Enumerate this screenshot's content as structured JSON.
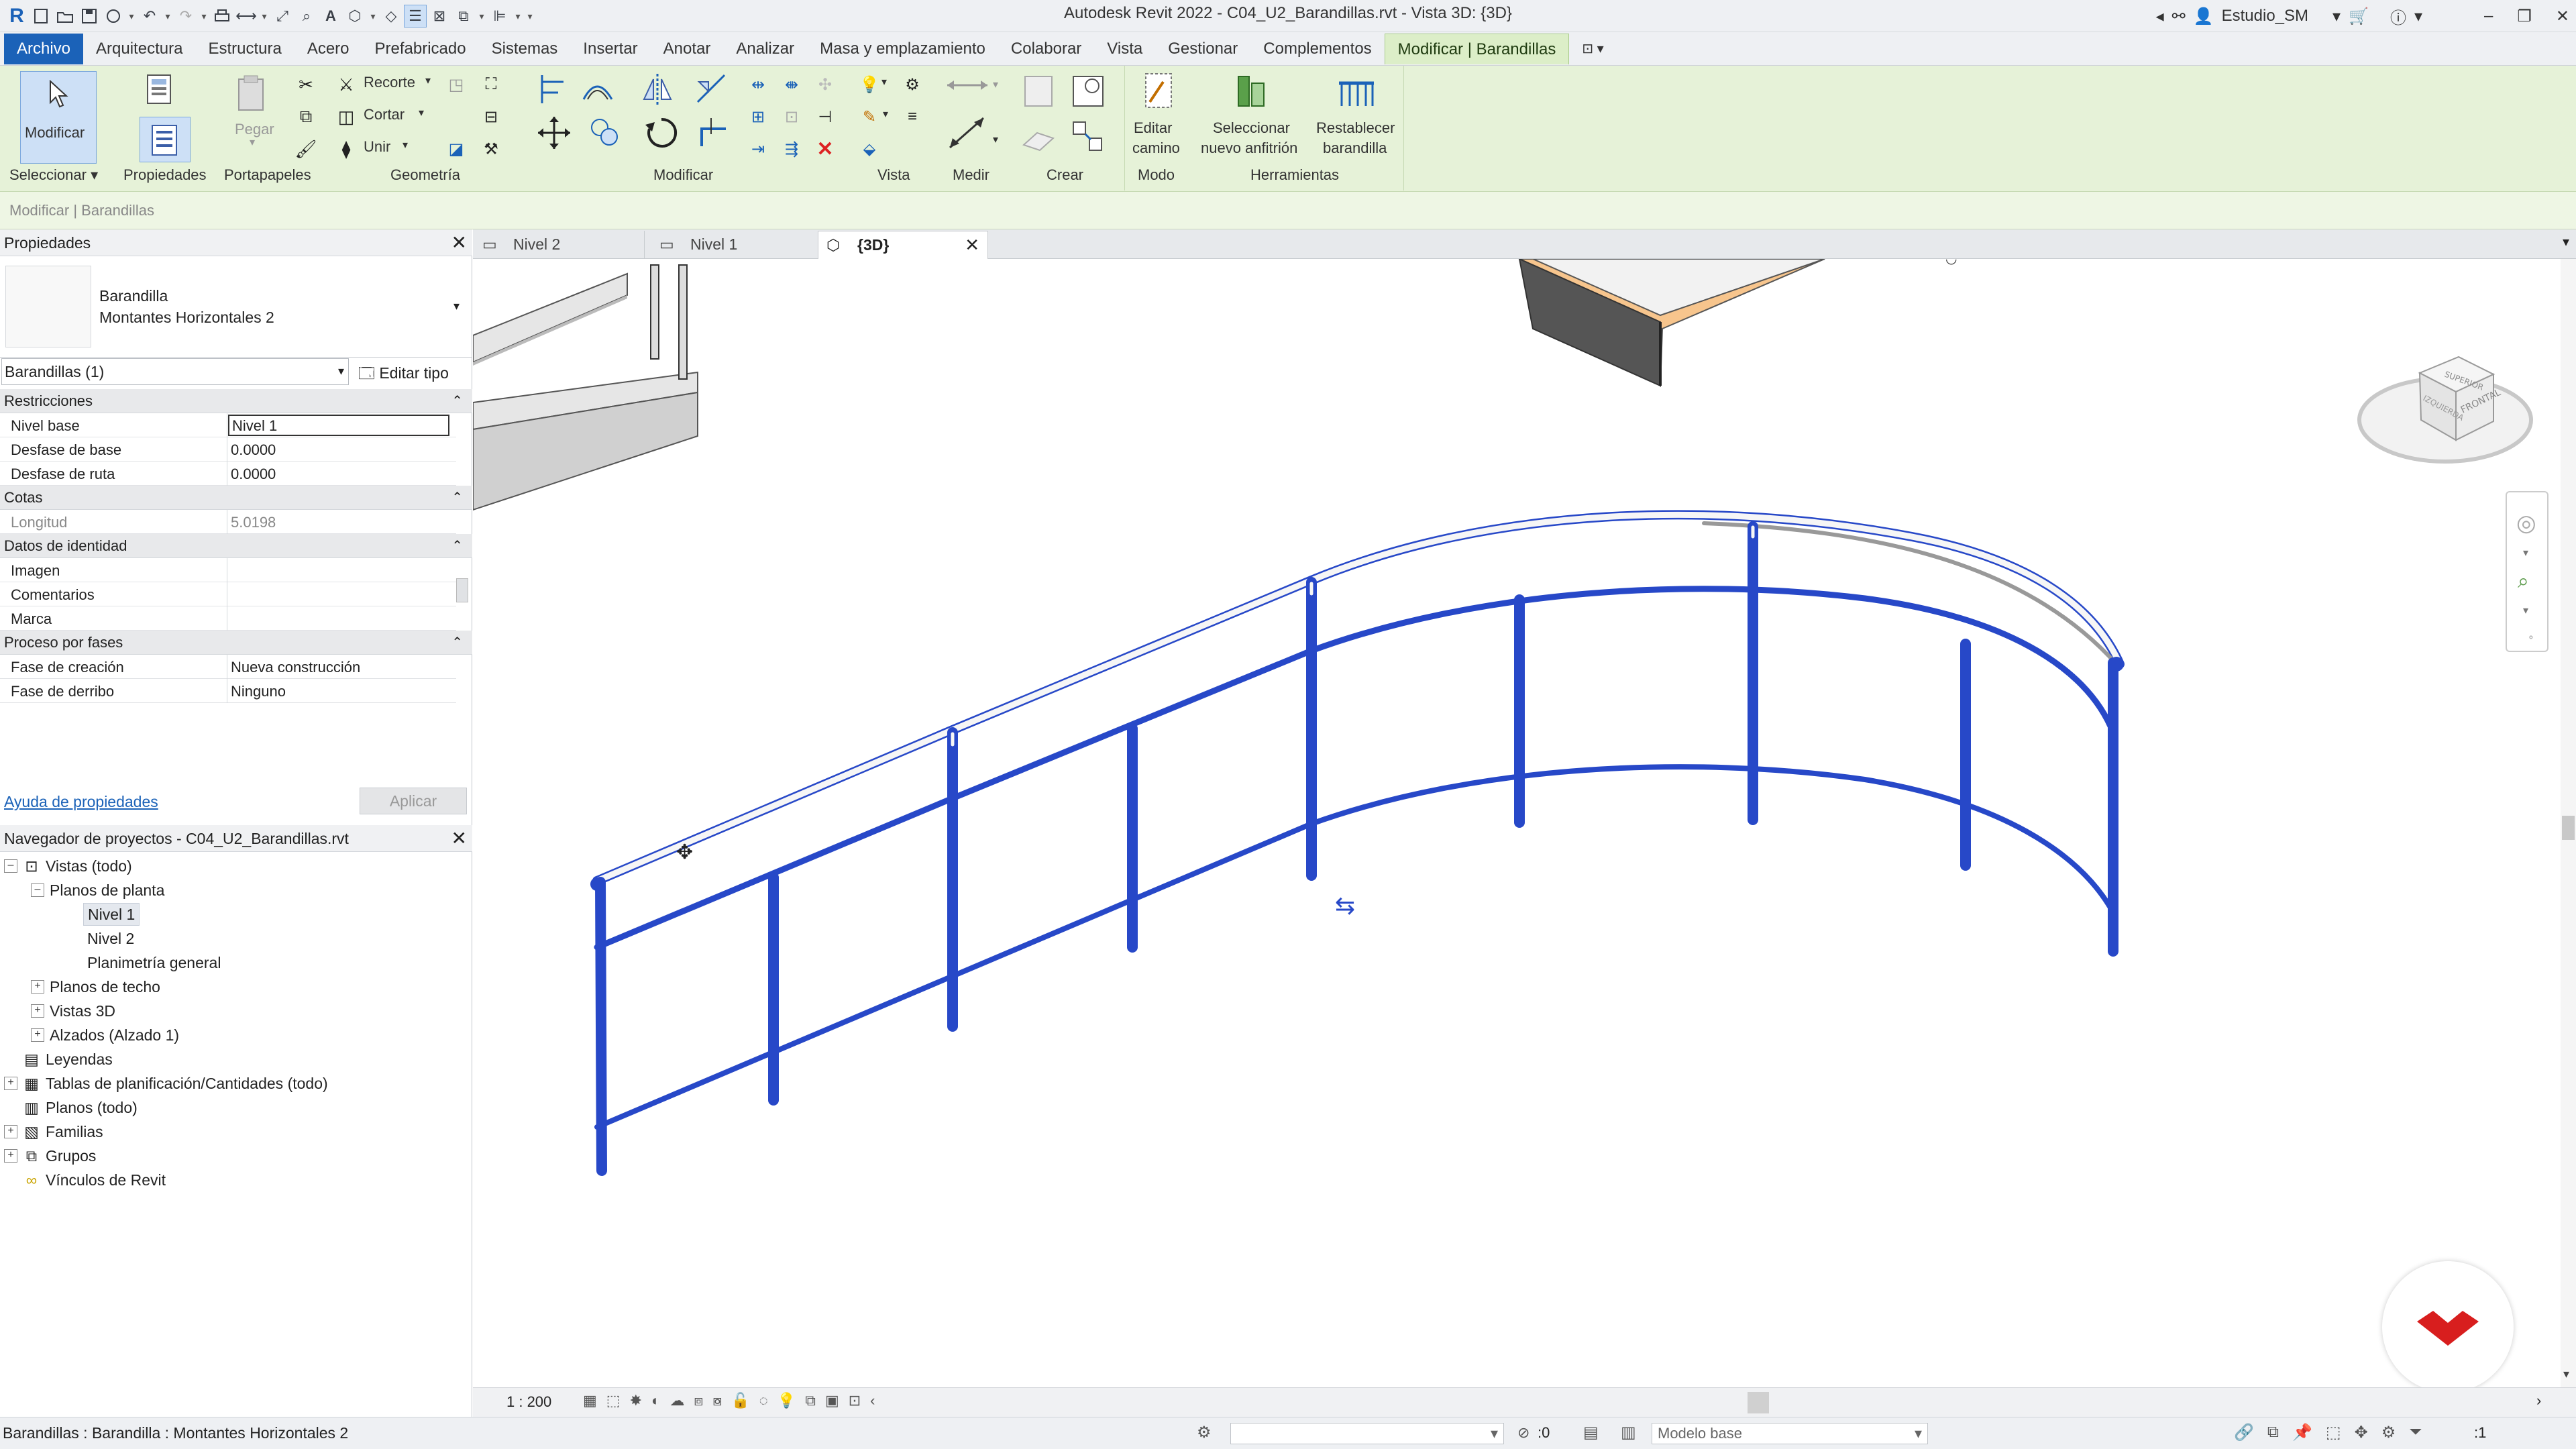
{
  "window": {
    "title": "Autodesk Revit 2022 - C04_U2_Barandillas.rvt - Vista 3D: {3D}",
    "user": "Estudio_SM"
  },
  "menu": {
    "tabs": [
      "Archivo",
      "Arquitectura",
      "Estructura",
      "Acero",
      "Prefabricado",
      "Sistemas",
      "Insertar",
      "Anotar",
      "Analizar",
      "Masa y emplazamiento",
      "Colaborar",
      "Vista",
      "Gestionar",
      "Complementos",
      "Modificar | Barandillas"
    ]
  },
  "ribbon": {
    "modify_label": "Modificar",
    "select_label": "Seleccionar",
    "panels": {
      "properties": "Propiedades",
      "clipboard": "Portapapeles",
      "geometry": "Geometría",
      "modify": "Modificar",
      "view": "Vista",
      "measure": "Medir",
      "create": "Crear",
      "mode": "Modo",
      "tools": "Herramientas"
    },
    "paste_label": "Pegar",
    "cope_label": "Recorte",
    "cut_label": "Cortar",
    "join_label": "Unir",
    "edit_path": [
      "Editar",
      "camino"
    ],
    "select_host": [
      "Seleccionar",
      "nuevo anfitrión"
    ],
    "reset_railing": [
      "Restablecer",
      "barandilla"
    ]
  },
  "options_bar": {
    "label": "Modificar | Barandillas"
  },
  "properties": {
    "header": "Propiedades",
    "family": "Barandilla",
    "type": "Montantes Horizontales 2",
    "selector": "Barandillas (1)",
    "edit_type": "Editar tipo",
    "categories": {
      "constraints": "Restricciones",
      "dimensions": "Cotas",
      "identity": "Datos de identidad",
      "phasing": "Proceso por fases"
    },
    "rows": {
      "base_level": {
        "k": "Nivel base",
        "v": "Nivel 1"
      },
      "base_offset": {
        "k": "Desfase de base",
        "v": "0.0000"
      },
      "path_offset": {
        "k": "Desfase de ruta",
        "v": "0.0000"
      },
      "length": {
        "k": "Longitud",
        "v": "5.0198"
      },
      "image": {
        "k": "Imagen",
        "v": ""
      },
      "comments": {
        "k": "Comentarios",
        "v": ""
      },
      "mark": {
        "k": "Marca",
        "v": ""
      },
      "phase_created": {
        "k": "Fase de creación",
        "v": "Nueva construcción"
      },
      "phase_demolished": {
        "k": "Fase de derribo",
        "v": "Ninguno"
      }
    },
    "help_link": "Ayuda de propiedades",
    "apply": "Aplicar"
  },
  "browser": {
    "header": "Navegador de proyectos - C04_U2_Barandillas.rvt",
    "nodes": {
      "views_all": "Vistas (todo)",
      "floor_plans": "Planos de planta",
      "level1": "Nivel 1",
      "level2": "Nivel 2",
      "site": "Planimetría general",
      "ceiling_plans": "Planos de techo",
      "views3d": "Vistas 3D",
      "elevations": "Alzados (Alzado 1)",
      "legends": "Leyendas",
      "schedules": "Tablas de planificación/Cantidades (todo)",
      "sheets": "Planos (todo)",
      "families": "Familias",
      "groups": "Grupos",
      "links": "Vínculos de Revit"
    }
  },
  "view_tabs": [
    "Nivel 2",
    "Nivel 1",
    "{3D}"
  ],
  "view_control": {
    "scale": "1 : 200"
  },
  "viewcube": {
    "top": "SUPERIOR",
    "left": "IZQUIERDA",
    "front": "FRONTAL"
  },
  "status": {
    "text": "Barandillas : Barandilla : Montantes Horizontales 2",
    "zero": ":0",
    "model": "Modelo base",
    "filter": ":1"
  },
  "colors": {
    "accent": "#1b62b8",
    "selection": "#2748c8",
    "ribbon_context": "#e6f2d8"
  }
}
